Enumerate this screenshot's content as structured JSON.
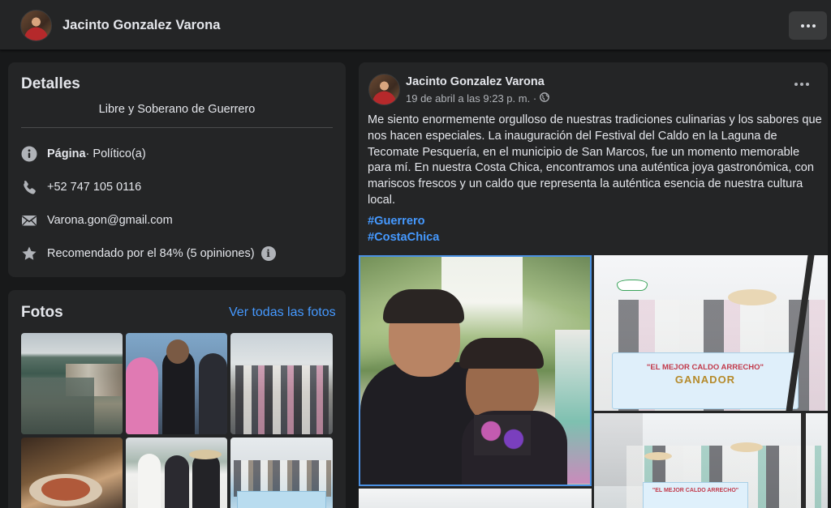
{
  "header": {
    "page_name": "Jacinto Gonzalez Varona"
  },
  "details": {
    "title": "Detalles",
    "bio": "Libre y Soberano de Guerrero",
    "category_label": "Página",
    "category_value": " · Político(a)",
    "phone": "+52 747 105 0116",
    "email": "Varona.gon@gmail.com",
    "recommendation": "Recomendado por el 84% (5 opiniones)"
  },
  "photos": {
    "title": "Fotos",
    "see_all": "Ver todas las fotos"
  },
  "post": {
    "author": "Jacinto Gonzalez Varona",
    "timestamp": "19 de abril a las 9:23 p. m. ·",
    "text": "Me siento enormemente orgulloso de nuestras tradiciones culinarias y los sabores que nos hacen especiales. La inauguración del Festival del Caldo en la Laguna de Tecomate Pesquería, en el municipio de San Marcos, fue un momento memorable para mí. En nuestra Costa Chica, encontramos una auténtica joya gastronómica, con mariscos frescos y un caldo que representa la auténtica esencia de nuestra cultura local.",
    "hashtags": [
      "#Guerrero",
      "#CostaChica"
    ],
    "banner_line1": "\"EL MEJOR CALDO ARRECHO\"",
    "banner_line2": "GANADOR",
    "banner_small": "\"EL MEJOR CALDO ARRECHO\""
  },
  "colors": {
    "background": "#18191a",
    "card": "#242526",
    "text_primary": "#e4e6eb",
    "text_secondary": "#b0b3b8",
    "link": "#4599ff"
  },
  "icons": [
    "ellipsis-icon",
    "info-icon",
    "phone-icon",
    "mail-icon",
    "star-icon",
    "globe-icon"
  ]
}
